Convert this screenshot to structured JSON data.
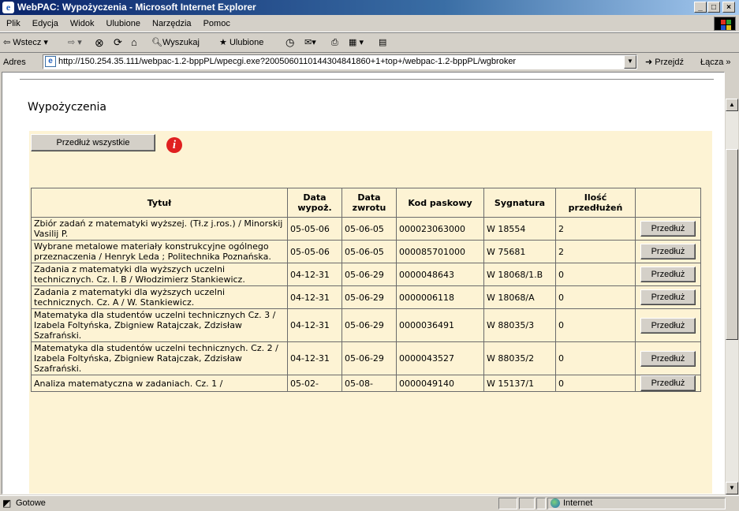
{
  "window": {
    "title": "WebPAC: Wypożyczenia - Microsoft Internet Explorer"
  },
  "menu": [
    "Plik",
    "Edycja",
    "Widok",
    "Ulubione",
    "Narzędzia",
    "Pomoc"
  ],
  "toolbar": {
    "back": "Wstecz",
    "search": "Wyszukaj",
    "favorites": "Ulubione"
  },
  "address": {
    "label": "Adres",
    "url": "http://150.254.35.111/webpac-1.2-bppPL/wpecgi.exe?2005060110144304841860+1+top+/webpac-1.2-bppPL/wgbroker",
    "go": "Przejdź",
    "links": "Łącza »"
  },
  "page": {
    "heading": "Wypożyczenia",
    "renew_all_label": "Przedłuż wszystkie",
    "info_icon_glyph": "i",
    "columns": [
      "Tytuł",
      "Data wypoż.",
      "Data zwrotu",
      "Kod paskowy",
      "Sygnatura",
      "Ilość przedłużeń",
      ""
    ],
    "renew_label": "Przedłuż",
    "rows": [
      {
        "title": "Zbiór zadań z matematyki wyższej. (Tł.z j.ros.) / Minorskij Vasilij P.",
        "loan": "05-05-06",
        "due": "05-06-05",
        "barcode": "000023063000",
        "callno": "W 18554",
        "renewals": "2"
      },
      {
        "title": "Wybrane metalowe materiały konstrukcyjne ogólnego przeznaczenia / Henryk Leda ; Politechnika Poznańska.",
        "loan": "05-05-06",
        "due": "05-06-05",
        "barcode": "000085701000",
        "callno": "W 75681",
        "renewals": "2"
      },
      {
        "title": "Zadania z matematyki dla wyższych uczelni technicznych. Cz. I. B / Włodzimierz Stankiewicz.",
        "loan": "04-12-31",
        "due": "05-06-29",
        "barcode": "0000048643",
        "callno": "W 18068/1.B",
        "renewals": "0"
      },
      {
        "title": "Zadania z matematyki dla wyższych uczelni technicznych. Cz. A / W. Stankiewicz.",
        "loan": "04-12-31",
        "due": "05-06-29",
        "barcode": "0000006118",
        "callno": "W 18068/A",
        "renewals": "0"
      },
      {
        "title": "Matematyka dla studentów uczelni technicznych Cz. 3 / Izabela Foltyńska, Zbigniew Ratajczak, Zdzisław Szafrański.",
        "loan": "04-12-31",
        "due": "05-06-29",
        "barcode": "0000036491",
        "callno": "W 88035/3",
        "renewals": "0"
      },
      {
        "title": "Matematyka dla studentów uczelni technicznych. Cz. 2 / Izabela Foltyńska, Zbigniew Ratajczak, Zdzisław Szafrański.",
        "loan": "04-12-31",
        "due": "05-06-29",
        "barcode": "0000043527",
        "callno": "W 88035/2",
        "renewals": "0"
      },
      {
        "title": "Analiza matematyczna w zadaniach. Cz. 1 /",
        "loan": "05-02-",
        "due": "05-08-",
        "barcode": "0000049140",
        "callno": "W 15137/1",
        "renewals": "0"
      }
    ]
  },
  "status": {
    "text": "Gotowe",
    "zone": "Internet"
  }
}
